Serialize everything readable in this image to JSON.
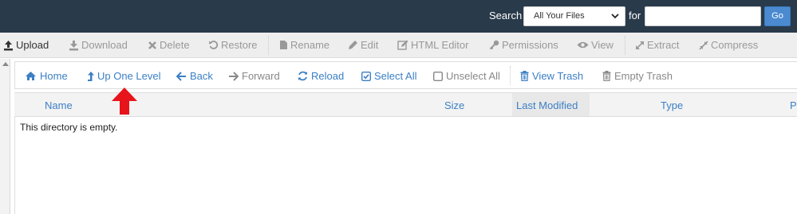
{
  "search": {
    "label": "Search",
    "scope_value": "All Your Files",
    "for_label": "for",
    "query_value": "",
    "go_label": "Go"
  },
  "toolbar": {
    "upload": "Upload",
    "download": "Download",
    "delete": "Delete",
    "restore": "Restore",
    "rename": "Rename",
    "edit": "Edit",
    "html_editor": "HTML Editor",
    "permissions": "Permissions",
    "view": "View",
    "extract": "Extract",
    "compress": "Compress"
  },
  "nav": {
    "home": "Home",
    "up_one_level": "Up One Level",
    "back": "Back",
    "forward": "Forward",
    "reload": "Reload",
    "select_all": "Select All",
    "unselect_all": "Unselect All",
    "view_trash": "View Trash",
    "empty_trash": "Empty Trash"
  },
  "table": {
    "columns": [
      "Name",
      "Size",
      "Last Modified",
      "Type",
      "P"
    ],
    "empty_message": "This directory is empty."
  },
  "colors": {
    "topbar": "#293a4a",
    "link_blue": "#3b7fc4",
    "go_button": "#4b8ad1",
    "annotation_red": "#e8141b"
  },
  "icons": [
    "upload-icon",
    "download-icon",
    "delete-icon",
    "restore-icon",
    "rename-icon",
    "edit-icon",
    "html-editor-icon",
    "permissions-icon",
    "view-icon",
    "extract-icon",
    "compress-icon",
    "home-icon",
    "up-level-icon",
    "back-arrow-icon",
    "forward-arrow-icon",
    "reload-icon",
    "checkbox-checked-icon",
    "checkbox-empty-icon",
    "trash-icon",
    "red-arrow-annotation"
  ]
}
